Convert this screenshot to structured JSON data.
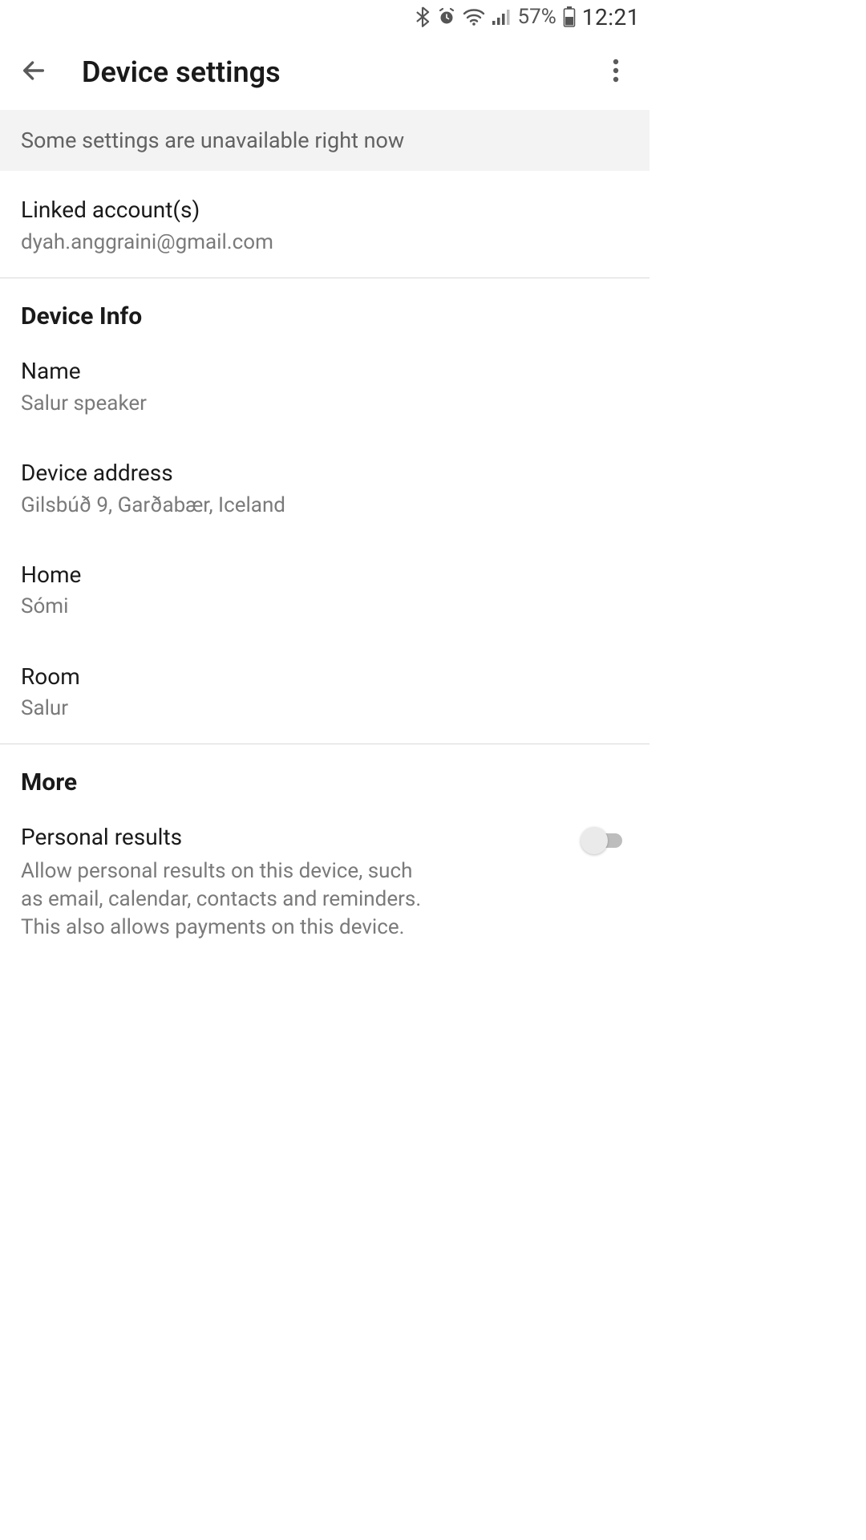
{
  "status_bar": {
    "battery_pct": "57%",
    "time": "12:21"
  },
  "header": {
    "title": "Device settings"
  },
  "banner": {
    "text": "Some settings are unavailable right now"
  },
  "linked_accounts": {
    "title": "Linked account(s)",
    "value": "dyah.anggraini@gmail.com"
  },
  "device_info": {
    "heading": "Device Info",
    "name": {
      "label": "Name",
      "value": "Salur speaker"
    },
    "address": {
      "label": "Device address",
      "value": "Gilsbúð 9, Garðabær, Iceland"
    },
    "home": {
      "label": "Home",
      "value": "Sómi"
    },
    "room": {
      "label": "Room",
      "value": "Salur"
    }
  },
  "more": {
    "heading": "More",
    "personal_results": {
      "label": "Personal results",
      "desc": "Allow personal results on this device, such as email, calendar, contacts and reminders. This also allows payments on this device.",
      "enabled": false
    }
  }
}
